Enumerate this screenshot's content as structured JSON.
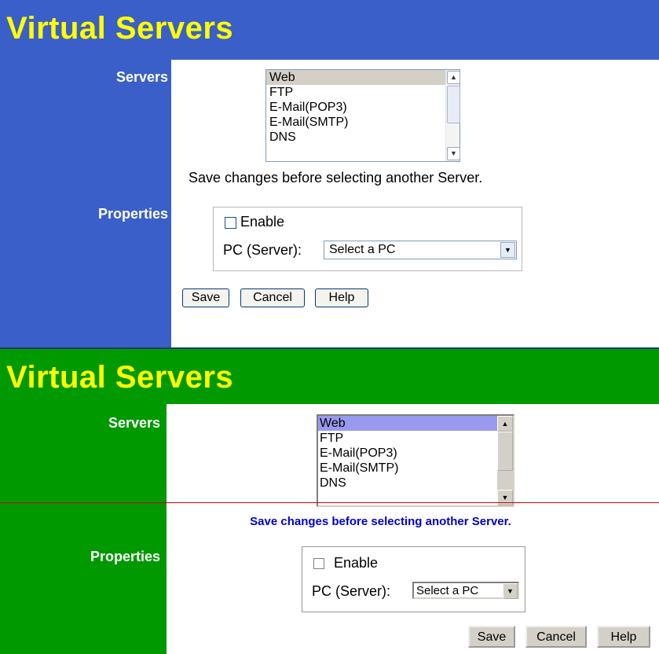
{
  "panel_blue": {
    "title": "Virtual Servers",
    "servers_label": "Servers",
    "properties_label": "Properties",
    "servers_list": [
      "Web",
      "FTP",
      "E-Mail(POP3)",
      "E-Mail(SMTP)",
      "DNS"
    ],
    "selected_server": "Web",
    "note": "Save changes before selecting another Server.",
    "enable_label": "Enable",
    "enable_checked": false,
    "pc_label": "PC (Server):",
    "pc_select_value": "Select a PC",
    "buttons": {
      "save": "Save",
      "cancel": "Cancel",
      "help": "Help"
    }
  },
  "panel_green": {
    "title": "Virtual Servers",
    "servers_label": "Servers",
    "properties_label": "Properties",
    "servers_list": [
      "Web",
      "FTP",
      "E-Mail(POP3)",
      "E-Mail(SMTP)",
      "DNS"
    ],
    "selected_server": "Web",
    "note": "Save changes before selecting another Server.",
    "enable_label": "Enable",
    "enable_checked": false,
    "pc_label": "PC (Server):",
    "pc_select_value": "Select a PC",
    "buttons": {
      "save": "Save",
      "cancel": "Cancel",
      "help": "Help"
    }
  },
  "colors": {
    "blue_header": "#3a5fc8",
    "green_header": "#009900",
    "title_yellow": "#ffff00",
    "note_blue": "#0000cc",
    "selection_purple": "#9999ee"
  },
  "icons": {
    "scroll_up": "scroll-up-arrow-icon",
    "scroll_down": "scroll-down-arrow-icon",
    "dropdown": "dropdown-arrow-icon"
  }
}
